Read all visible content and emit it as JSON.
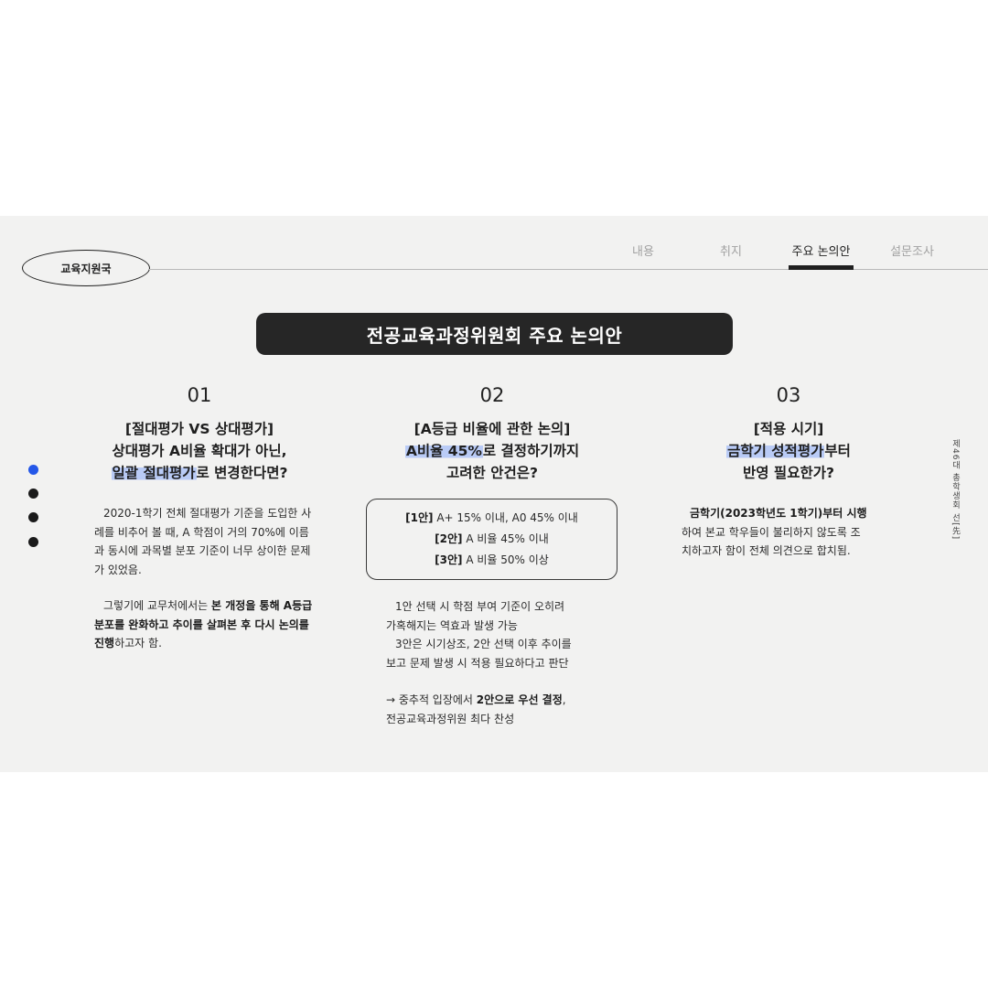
{
  "org": "교육지원국",
  "nav": {
    "tabs": [
      {
        "label": "내용"
      },
      {
        "label": "취지"
      },
      {
        "label": "주요 논의안"
      },
      {
        "label": "설문조사"
      }
    ]
  },
  "banner": {
    "title": "전공교육과정위원회 주요 논의안"
  },
  "side_caption": "제46대 총학생회 선[先]",
  "columns": [
    {
      "number": "01",
      "head_line1": "[절대평가 VS 상대평가]",
      "head_line2": "상대평가 A비율 확대가 아닌,",
      "head_line3_hl": "일괄 절대평가",
      "head_line3_rest": "로 변경한다면?",
      "p1": "2020-1학기 전체 절대평가 기준을 도입한 사례를 비추어 볼 때, A 학점이 거의 70%에 이름과 동시에 과목별 분포 기준이 너무 상이한 문제가 있었음.",
      "p2_pre": "그렇기에 교무처에서는 ",
      "p2_bold": "본 개정을 통해 A등급 분포를 완화하고 추이를 살펴본 후 다시 논의를 진행",
      "p2_post": "하고자 함."
    },
    {
      "number": "02",
      "head_line1": "[A등급 비율에 관한 논의]",
      "head_line2_hl": "A비율 45%",
      "head_line2_rest": "로 결정하기까지",
      "head_line3": "고려한 안건은?",
      "options": [
        {
          "tag": "[1안]",
          "text": " A+ 15% 이내,  A0 45% 이내"
        },
        {
          "tag": "[2안]",
          "text": " A 비율 45% 이내"
        },
        {
          "tag": "[3안]",
          "text": " A 비율 50% 이상"
        }
      ],
      "p1_line1": "1안 선택 시 학점 부여 기준이 오히려",
      "p1_line2": "가혹해지는 역효과 발생 가능",
      "p1_line3": "3안은 시기상조, 2안 선택 이후 추이를",
      "p1_line4": "보고 문제 발생 시 적용 필요하다고 판단",
      "p2_pre": "→ 중추적 입장에서 ",
      "p2_bold": "2안으로 우선 결정",
      "p2_post": ",",
      "p2_line2": "전공교육과정위원 최다 찬성"
    },
    {
      "number": "03",
      "head_line1": "[적용 시기]",
      "head_line2_hl": "금학기 성적평가",
      "head_line2_rest": "부터",
      "head_line3": "반영 필요한가?",
      "p1_bold": "금학기(2023학년도 1학기)부터 시행",
      "p1_line2": "하여 본교 학우들이 불리하지 않도록 조",
      "p1_line3": "치하고자 함이 전체 의견으로 합치됨."
    }
  ],
  "colors": {
    "accent": "#2457e8",
    "highlight": "#b9cbf6",
    "banner_bg": "#262626"
  },
  "pagination": {
    "active_index": 0,
    "count": 4
  }
}
